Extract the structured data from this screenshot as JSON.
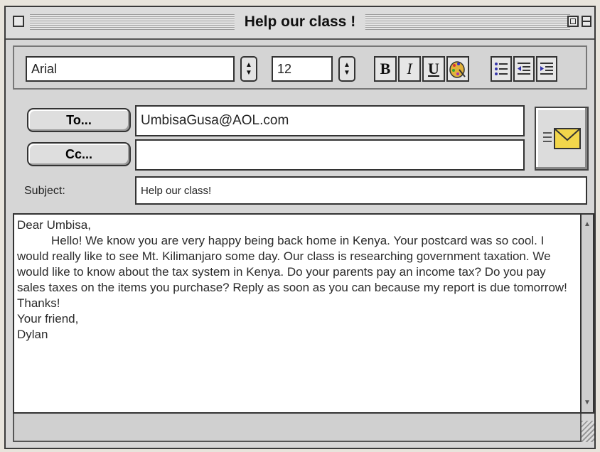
{
  "window": {
    "title": "Help our class !"
  },
  "toolbar": {
    "font": "Arial",
    "size": "12",
    "bold_label": "B",
    "italic_label": "I",
    "underline_label": "U"
  },
  "header": {
    "to_label": "To...",
    "to_value": "UmbisaGusa@AOL.com",
    "cc_label": "Cc...",
    "cc_value": "",
    "subject_label": "Subject:",
    "subject_value": "Help our class!"
  },
  "message": {
    "greeting": "Dear Umbisa,",
    "body": "Hello! We know you are very happy being back home in Kenya. Your postcard was so cool. I would really like to see Mt. Kilimanjaro some day. Our class is researching government taxation. We would like to know about the tax system in Kenya. Do your parents pay an income tax? Do you pay sales taxes on the items you purchase? Reply as soon as you can because my report is due tomorrow! Thanks!",
    "closing": "Your friend,",
    "signature": "Dylan"
  },
  "icons": {
    "send": "send-envelope-icon",
    "color": "color-palette-icon",
    "bullets": "bulleted-list-icon",
    "outdent": "decrease-indent-icon",
    "indent": "increase-indent-icon"
  },
  "colors": {
    "envelope": "#f2d64b",
    "palette": "#e2b23a"
  }
}
